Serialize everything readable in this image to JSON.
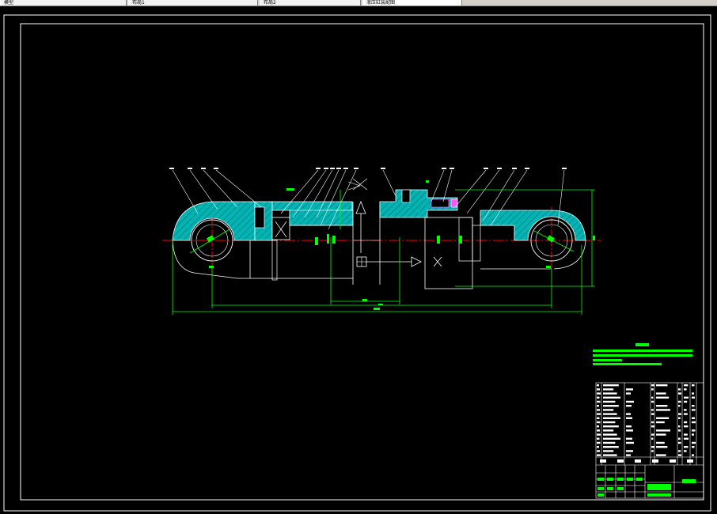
{
  "tabs": [
    {
      "label": "模型"
    },
    {
      "label": "布局1"
    },
    {
      "label": "布局2"
    },
    {
      "label": "液压缸装配图"
    }
  ],
  "colors": {
    "background": "#000000",
    "border": "#ffffff",
    "hatch": "#00c8c8",
    "dimension": "#00ff00",
    "centerline": "#ff0000",
    "outline": "#ffffff"
  },
  "icons": [
    "tab-icon"
  ]
}
